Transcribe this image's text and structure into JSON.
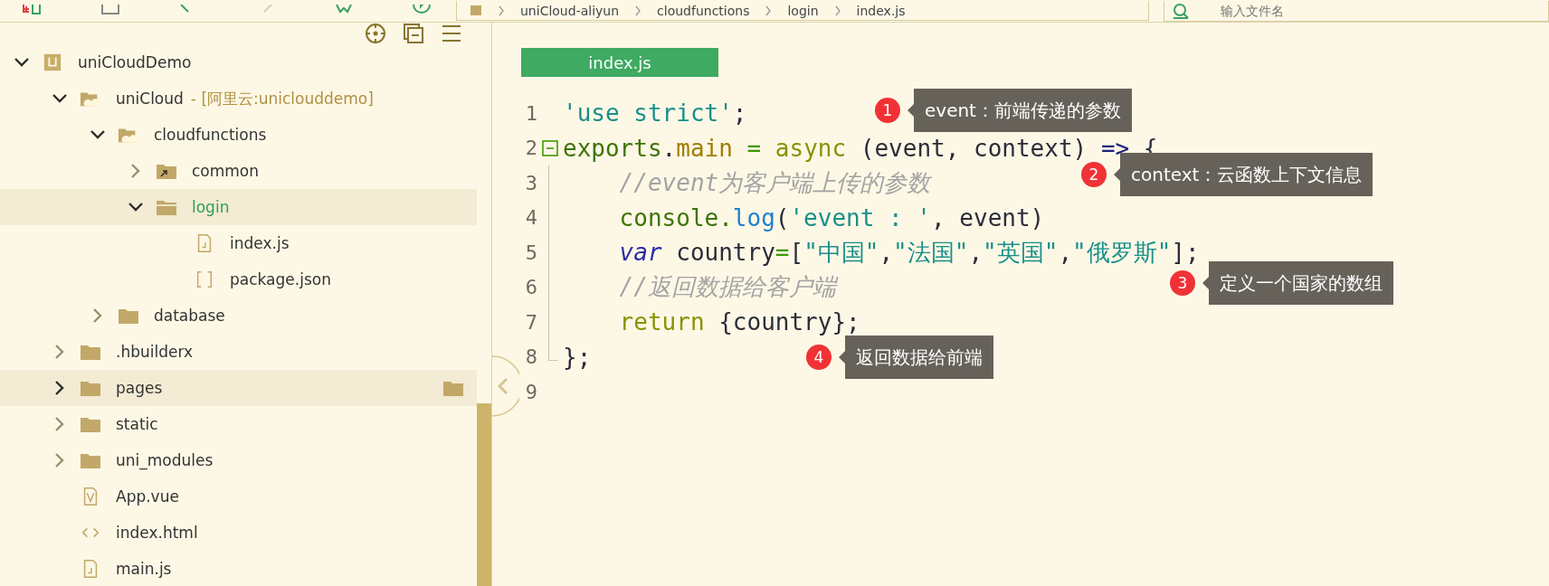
{
  "toolbar": {
    "breadcrumb": [
      "uniCloud-aliyun",
      "cloudfunctions",
      "login",
      "index.js"
    ],
    "search": {
      "placeholder": "输入文件名"
    }
  },
  "sidebar": {
    "tree": [
      {
        "label": "uniCloudDemo",
        "kind": "project",
        "expanded": true,
        "selected": false,
        "children": [
          {
            "label": "uniCloud",
            "suffix": "- [阿里云:uniclouddemo]",
            "kind": "cloud-folder",
            "expanded": true,
            "selected": false,
            "children": [
              {
                "label": "cloudfunctions",
                "kind": "cloud-folder",
                "expanded": true,
                "selected": false,
                "children": [
                  {
                    "label": "common",
                    "kind": "link-folder",
                    "expanded": false,
                    "selected": false
                  },
                  {
                    "label": "login",
                    "kind": "folder",
                    "expanded": true,
                    "selected": true,
                    "children": [
                      {
                        "label": "index.js",
                        "kind": "js-file",
                        "selected": false
                      },
                      {
                        "label": "package.json",
                        "kind": "json-file",
                        "selected": false
                      }
                    ]
                  }
                ]
              },
              {
                "label": "database",
                "kind": "folder",
                "expanded": false,
                "selected": false
              }
            ]
          },
          {
            "label": ".hbuilderx",
            "kind": "folder",
            "expanded": false,
            "selected": false
          },
          {
            "label": "pages",
            "kind": "folder",
            "expanded": false,
            "selected": false,
            "hovered": true
          },
          {
            "label": "static",
            "kind": "folder",
            "expanded": false,
            "selected": false
          },
          {
            "label": "uni_modules",
            "kind": "folder",
            "expanded": false,
            "selected": false
          },
          {
            "label": "App.vue",
            "kind": "vue-file",
            "selected": false
          },
          {
            "label": "index.html",
            "kind": "html-file",
            "selected": false
          },
          {
            "label": "main.js",
            "kind": "js-file",
            "selected": false
          }
        ]
      }
    ]
  },
  "editor": {
    "tab": {
      "label": "index.js",
      "selected": true
    },
    "lines": [
      {
        "number": "1",
        "tokens": [
          {
            "text": "'use strict'",
            "kind": "string"
          },
          {
            "text": ";",
            "kind": "plain"
          }
        ]
      },
      {
        "number": "2",
        "fold": true,
        "tokens": [
          {
            "text": "exports",
            "kind": "object"
          },
          {
            "text": ".",
            "kind": "plain"
          },
          {
            "text": "main",
            "kind": "property"
          },
          {
            "text": " = ",
            "kind": "operator"
          },
          {
            "text": "async",
            "kind": "keyword"
          },
          {
            "text": " (event, context) ",
            "kind": "plain"
          },
          {
            "text": "=>",
            "kind": "arrow"
          },
          {
            "text": " {",
            "kind": "plain"
          }
        ]
      },
      {
        "number": "3",
        "guide": true,
        "tokens": [
          {
            "text": "    //event为客户端上传的参数",
            "kind": "comment"
          }
        ]
      },
      {
        "number": "4",
        "guide": true,
        "tokens": [
          {
            "text": "    console.",
            "kind": "object"
          },
          {
            "text": "log",
            "kind": "function"
          },
          {
            "text": "(",
            "kind": "plain"
          },
          {
            "text": "'event : '",
            "kind": "string"
          },
          {
            "text": ", event)",
            "kind": "plain"
          }
        ]
      },
      {
        "number": "5",
        "guide": true,
        "tokens": [
          {
            "text": "    var",
            "kind": "declare"
          },
          {
            "text": " country",
            "kind": "plain"
          },
          {
            "text": "=",
            "kind": "operator"
          },
          {
            "text": "[",
            "kind": "plain"
          },
          {
            "text": "\"中国\"",
            "kind": "string"
          },
          {
            "text": ",",
            "kind": "plain"
          },
          {
            "text": "\"法国\"",
            "kind": "string"
          },
          {
            "text": ",",
            "kind": "plain"
          },
          {
            "text": "\"英国\"",
            "kind": "string"
          },
          {
            "text": ",",
            "kind": "plain"
          },
          {
            "text": "\"俄罗斯\"",
            "kind": "string"
          },
          {
            "text": "];",
            "kind": "plain"
          }
        ]
      },
      {
        "number": "6",
        "guide": true,
        "tokens": [
          {
            "text": "    //返回数据给客户端",
            "kind": "comment"
          }
        ]
      },
      {
        "number": "7",
        "guide": true,
        "tokens": [
          {
            "text": "    return",
            "kind": "keyword"
          },
          {
            "text": " {country};",
            "kind": "plain"
          }
        ]
      },
      {
        "number": "8",
        "guide_end": true,
        "tokens": [
          {
            "text": "};",
            "kind": "plain"
          }
        ]
      },
      {
        "number": "9"
      }
    ]
  },
  "annotations": [
    {
      "badge": "1",
      "text": "event：前端传递的参数"
    },
    {
      "badge": "2",
      "text": "context：云函数上下文信息"
    },
    {
      "badge": "3",
      "text": "定义一个国家的数组"
    },
    {
      "badge": "4",
      "text": "返回数据给前端"
    }
  ]
}
